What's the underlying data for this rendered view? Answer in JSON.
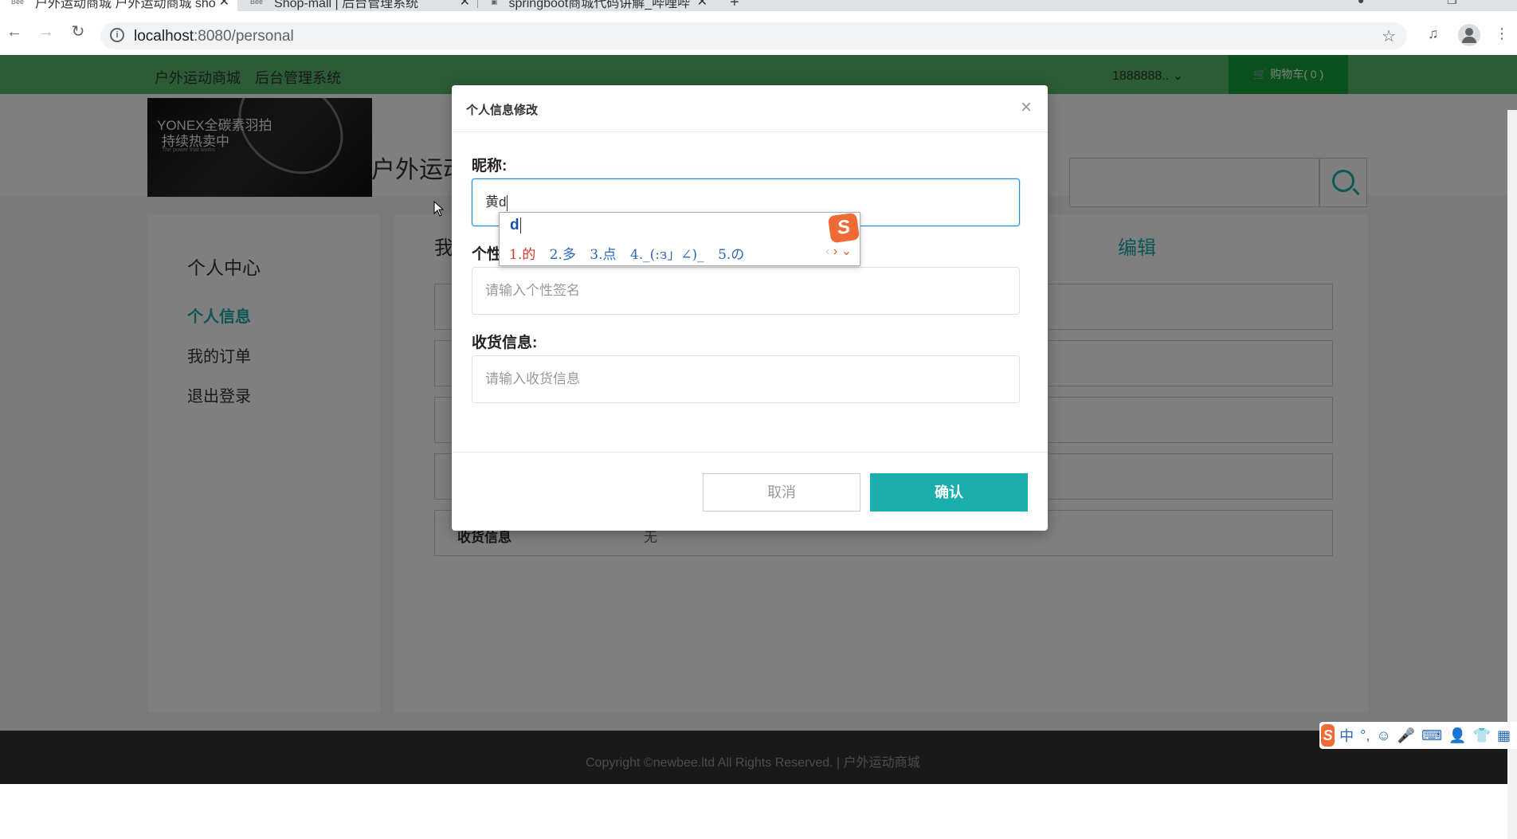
{
  "browser": {
    "tabs": [
      {
        "favicon": "Bee",
        "title": "户外运动商城 户外运动商城 sho"
      },
      {
        "favicon": "Bee",
        "title": "Shop-mall | 后台管理系统"
      },
      {
        "favicon": "",
        "title": "springboot商城代码讲解_哔哩哔"
      }
    ],
    "url_host": "localhost",
    "url_path": ":8080/personal"
  },
  "topnav": {
    "link1": "户外运动商城",
    "link2": "后台管理系统",
    "user": "1888888..",
    "cart": "购物车( 0 )"
  },
  "header": {
    "banner_line1": "YONEX全碳素羽拍",
    "banner_line2": "持续热卖中",
    "banner_line3": "The power that works",
    "brand": "户外运动"
  },
  "sidebar": {
    "title": "个人中心",
    "items": [
      {
        "label": "个人信息",
        "active": true
      },
      {
        "label": "我的订单",
        "active": false
      },
      {
        "label": "退出登录",
        "active": false
      }
    ]
  },
  "main": {
    "heading": "我",
    "edit": "编辑",
    "last_row_label": "收货信息",
    "last_row_value": "无"
  },
  "footer": {
    "text": "Copyright ©newbee.ltd All Rights Reserved.  |   户外运动商城"
  },
  "modal": {
    "title": "个人信息修改",
    "close": "×",
    "nickname_label": "昵称:",
    "nickname_value": "黄d",
    "signature_label": "个性",
    "signature_placeholder": "请输入个性签名",
    "address_label": "收货信息:",
    "address_placeholder": "请输入收货信息",
    "cancel": "取消",
    "confirm": "确认"
  },
  "ime": {
    "composition": "d",
    "candidates": [
      "1.的",
      "2.多",
      "3.点",
      "4._(:з」∠)_",
      "5.の"
    ],
    "bar": [
      "中",
      "°,",
      "☺",
      "🎤",
      "⌨",
      "👤",
      "👕",
      "▦"
    ]
  },
  "colors": {
    "accent": "#1baeae",
    "topnav": "#57b96b",
    "cart": "#15a33a"
  }
}
